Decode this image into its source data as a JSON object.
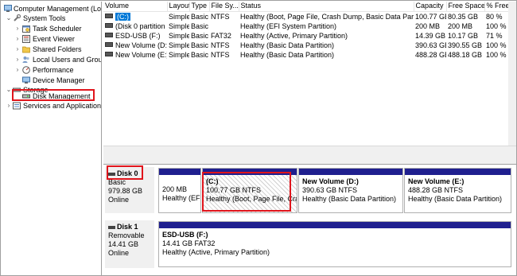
{
  "tree": {
    "root": "Computer Management (Local",
    "system_tools": "System Tools",
    "task_scheduler": "Task Scheduler",
    "event_viewer": "Event Viewer",
    "shared_folders": "Shared Folders",
    "local_users": "Local Users and Groups",
    "performance": "Performance",
    "device_manager": "Device Manager",
    "storage": "Storage",
    "disk_management": "Disk Management",
    "services": "Services and Applications"
  },
  "volume_table": {
    "headers": [
      "Volume",
      "Layout",
      "Type",
      "File Sy...",
      "Status",
      "Capacity",
      "Free Space",
      "% Free"
    ],
    "rows": [
      [
        "(C:)",
        "Simple",
        "Basic",
        "NTFS",
        "Healthy (Boot, Page File, Crash Dump, Basic Data Partition)",
        "100.77 GB",
        "80.35 GB",
        "80 %"
      ],
      [
        "(Disk 0 partition 1)",
        "Simple",
        "Basic",
        "",
        "Healthy (EFI System Partition)",
        "200 MB",
        "200 MB",
        "100 %"
      ],
      [
        "ESD-USB (F:)",
        "Simple",
        "Basic",
        "FAT32",
        "Healthy (Active, Primary Partition)",
        "14.39 GB",
        "10.17 GB",
        "71 %"
      ],
      [
        "New Volume (D:)",
        "Simple",
        "Basic",
        "NTFS",
        "Healthy (Basic Data Partition)",
        "390.63 GB",
        "390.55 GB",
        "100 %"
      ],
      [
        "New Volume (E:)",
        "Simple",
        "Basic",
        "NTFS",
        "Healthy (Basic Data Partition)",
        "488.28 GB",
        "488.18 GB",
        "100 %"
      ]
    ]
  },
  "disk0": {
    "name": "Disk 0",
    "type": "Basic",
    "size": "979.88 GB",
    "status": "Online",
    "partitions": [
      {
        "title": "",
        "size": "200 MB",
        "status": "Healthy (EFI"
      },
      {
        "title": "(C:)",
        "size": "100.77 GB NTFS",
        "status": "Healthy (Boot, Page File, Crash"
      },
      {
        "title": "New Volume  (D:)",
        "size": "390.63 GB NTFS",
        "status": "Healthy (Basic Data Partition)"
      },
      {
        "title": "New Volume  (E:)",
        "size": "488.28 GB NTFS",
        "status": "Healthy (Basic Data Partition)"
      }
    ]
  },
  "disk1": {
    "name": "Disk 1",
    "type": "Removable",
    "size": "14.41 GB",
    "status": "Online",
    "partitions": [
      {
        "title": "ESD-USB  (F:)",
        "size": "14.41 GB FAT32",
        "status": "Healthy (Active, Primary Partition)"
      }
    ]
  },
  "colors": {
    "accent_bar": "#1f1f8f",
    "highlight_box": "#e0151c",
    "selection": "#0078d7"
  }
}
